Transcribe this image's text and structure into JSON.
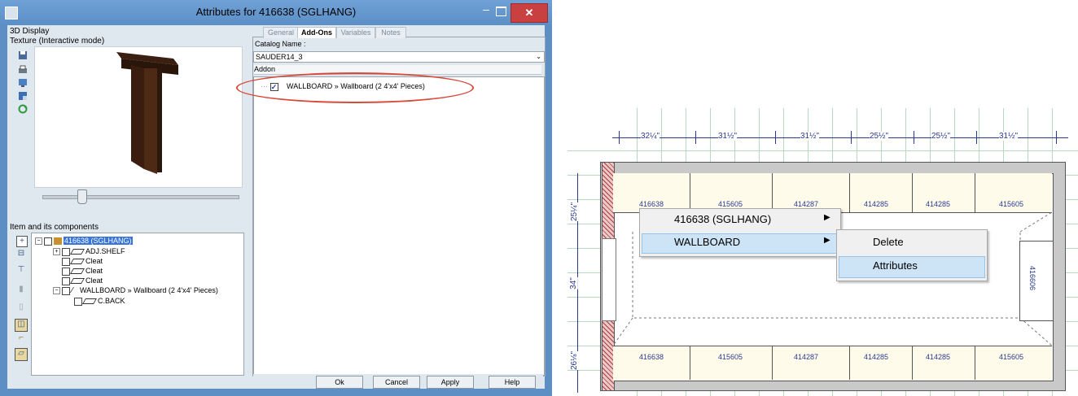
{
  "dialog": {
    "title": "Attributes for 416638 (SGLHANG)",
    "close_glyph": "✕",
    "min_glyph": "–",
    "display_label": "3D Display",
    "texture_label": "Texture (Interactive mode)",
    "components_label": "Item and its components",
    "tree": [
      {
        "text": "416638 (SGLHANG)",
        "level": 0,
        "selected": true
      },
      {
        "text": "ADJ.SHELF",
        "level": 1
      },
      {
        "text": "Cleat",
        "level": 1
      },
      {
        "text": "Cleat",
        "level": 1
      },
      {
        "text": "Cleat",
        "level": 1
      },
      {
        "text": "WALLBOARD » Wallboard (2 4'x4' Pieces)",
        "level": 1
      },
      {
        "text": "C.BACK",
        "level": 2
      }
    ],
    "tabs": [
      "General",
      "Add-Ons",
      "Variables",
      "Notes"
    ],
    "active_tab": "Add-Ons",
    "catalog_label": "Catalog Name :",
    "catalog_value": "SAUDER14_3",
    "addon_header": "Addon",
    "addon_item": "WALLBOARD » Wallboard (2 4'x4' Pieces)",
    "addon_checked": true,
    "buttons": {
      "ok": "Ok",
      "cancel": "Cancel",
      "apply": "Apply",
      "help": "Help"
    },
    "accent_color": "#5b8fc6",
    "highlight_color": "#d84a3a"
  },
  "plan": {
    "top_dims": [
      "32¼\"",
      "31½\"",
      "31½\"",
      "25½\"",
      "25½\"",
      "31½\""
    ],
    "left_dims": [
      "25¼\"",
      "34\"",
      "26⅛\""
    ],
    "top_row_codes": [
      "416638",
      "415605",
      "414287",
      "414285",
      "414285",
      "415605"
    ],
    "bottom_row_codes": [
      "416638",
      "415605",
      "414287",
      "414285",
      "414285",
      "415605"
    ],
    "side_code": "416606",
    "context_menu": {
      "items": [
        "416638 (SGLHANG)",
        "WALLBOARD"
      ],
      "submenu": [
        "Delete",
        "Attributes"
      ],
      "highlighted_item": "WALLBOARD",
      "highlighted_sub": "Attributes"
    }
  }
}
